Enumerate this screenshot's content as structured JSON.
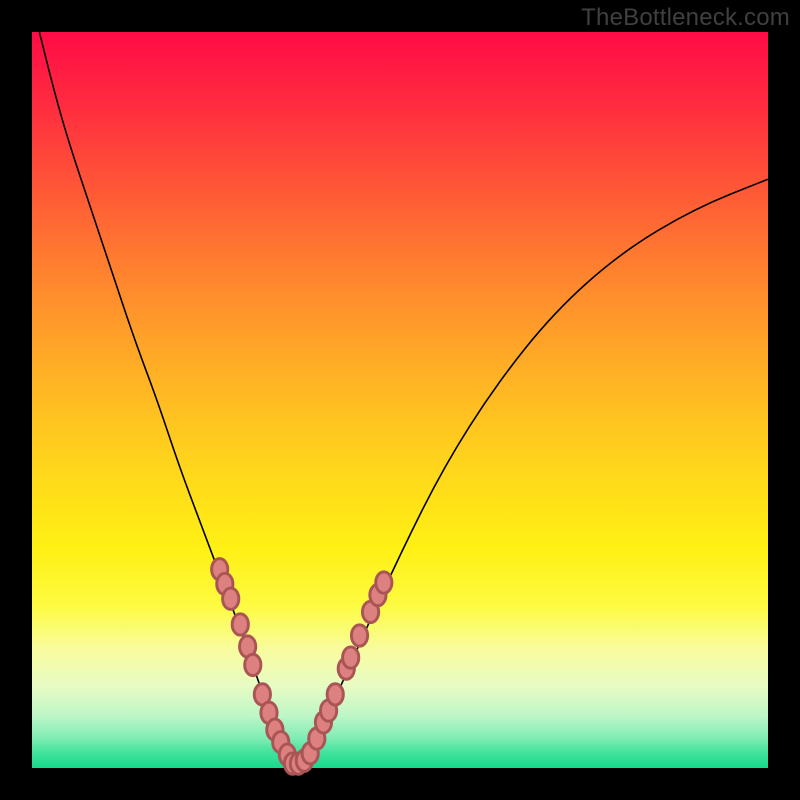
{
  "watermark": "TheBottleneck.com",
  "chart_data": {
    "type": "line",
    "title": "",
    "xlabel": "",
    "ylabel": "",
    "xlim": [
      0,
      100
    ],
    "ylim": [
      0,
      100
    ],
    "axes_visible": false,
    "background": "rainbow-vertical-gradient",
    "series": [
      {
        "name": "bottleneck-curve",
        "color": "#000000",
        "x": [
          1,
          3,
          5,
          8,
          11,
          14,
          17,
          20,
          23,
          26,
          29,
          31,
          33,
          34.5,
          36,
          38,
          41,
          45,
          50,
          56,
          63,
          71,
          80,
          90,
          100
        ],
        "y": [
          100,
          92,
          85,
          76,
          67,
          58,
          50,
          41,
          33,
          25,
          17,
          11,
          6,
          2,
          0,
          3,
          9,
          18,
          29,
          41,
          52,
          62,
          70,
          76,
          80
        ]
      }
    ],
    "markers": [
      {
        "name": "left-cluster",
        "color": "#dd8080",
        "points": [
          {
            "x": 25.5,
            "y": 27
          },
          {
            "x": 26.2,
            "y": 25
          },
          {
            "x": 27.0,
            "y": 23
          },
          {
            "x": 28.3,
            "y": 19.5
          },
          {
            "x": 29.3,
            "y": 16.5
          },
          {
            "x": 30.0,
            "y": 14
          },
          {
            "x": 31.3,
            "y": 10
          },
          {
            "x": 32.2,
            "y": 7.5
          },
          {
            "x": 33.0,
            "y": 5.2
          },
          {
            "x": 33.8,
            "y": 3.5
          },
          {
            "x": 34.7,
            "y": 1.8
          }
        ]
      },
      {
        "name": "bottom-cluster",
        "color": "#dd8080",
        "points": [
          {
            "x": 35.4,
            "y": 0.6
          },
          {
            "x": 36.2,
            "y": 0.6
          },
          {
            "x": 37.0,
            "y": 1.0
          },
          {
            "x": 37.8,
            "y": 2.0
          }
        ]
      },
      {
        "name": "right-cluster",
        "color": "#dd8080",
        "points": [
          {
            "x": 38.7,
            "y": 4.0
          },
          {
            "x": 39.6,
            "y": 6.2
          },
          {
            "x": 40.3,
            "y": 7.8
          },
          {
            "x": 41.2,
            "y": 10.0
          },
          {
            "x": 42.7,
            "y": 13.5
          },
          {
            "x": 43.3,
            "y": 15.0
          },
          {
            "x": 44.5,
            "y": 18.0
          },
          {
            "x": 46.0,
            "y": 21.2
          },
          {
            "x": 47.0,
            "y": 23.5
          },
          {
            "x": 47.8,
            "y": 25.2
          }
        ]
      }
    ]
  }
}
